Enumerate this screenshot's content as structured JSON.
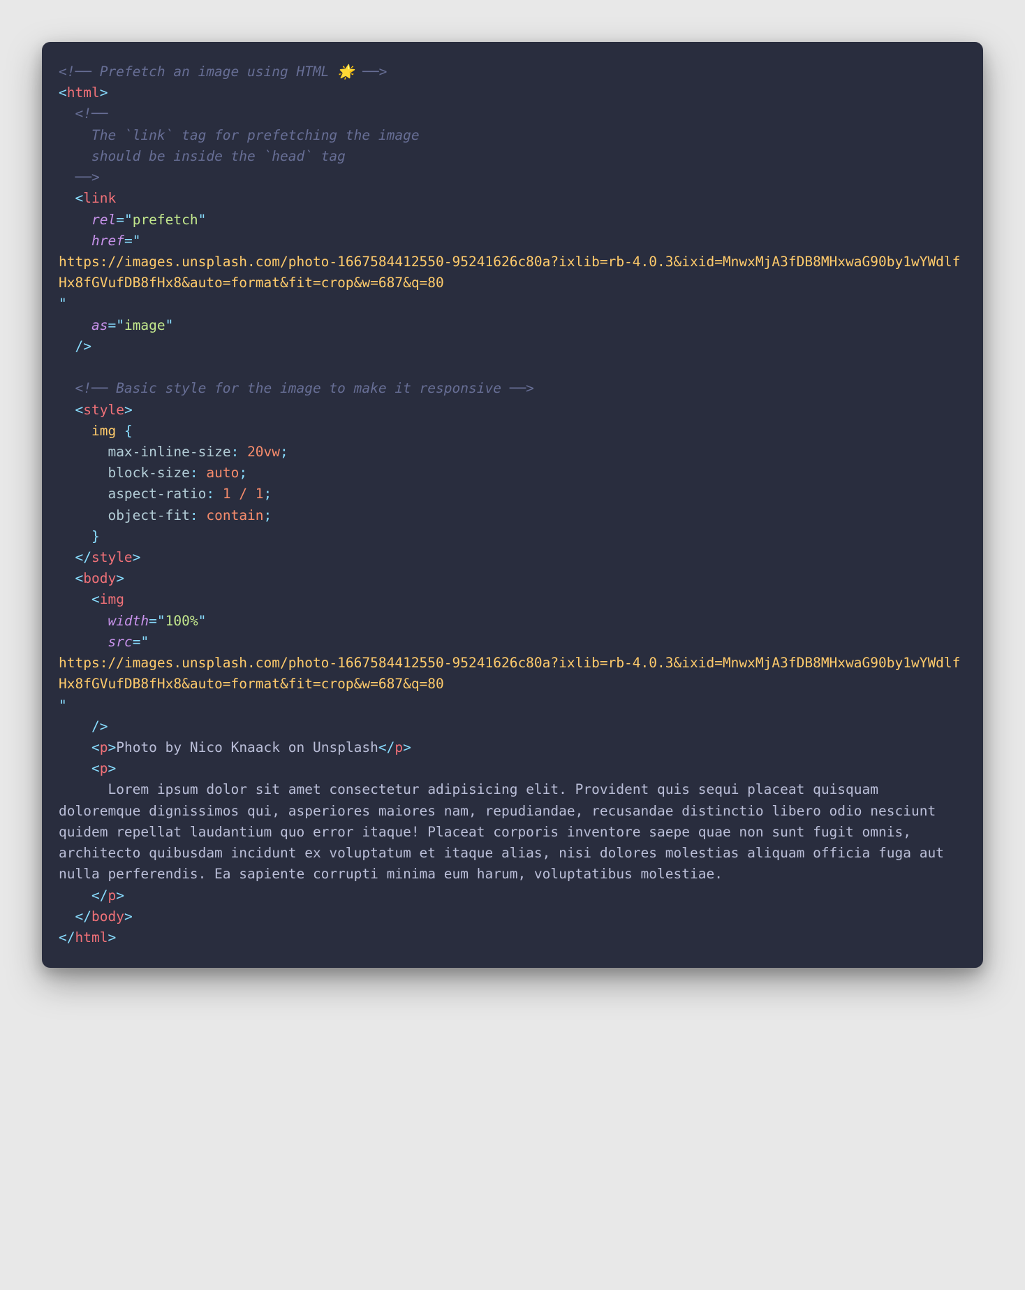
{
  "code": {
    "comment1": "<!── Prefetch an image using HTML 🌟 ──>",
    "htmlOpen": "html",
    "comment2_open": "<!──",
    "comment2_line1": "The `link` tag for prefetching the image",
    "comment2_line2": "should be inside the `head` tag",
    "comment2_close": "──>",
    "linkTag": "link",
    "relAttr": "rel",
    "relVal": "prefetch",
    "hrefAttr": "href",
    "url": "https://images.unsplash.com/photo-1667584412550-95241626c80a?ixlib=rb-4.0.3&ixid=MnwxMjA3fDB8MHxwaG90by1wYWdlfHx8fGVufDB8fHx8&auto=format&fit=crop&w=687&q=80",
    "asAttr": "as",
    "asVal": "image",
    "comment3": "<!── Basic style for the image to make it responsive ──>",
    "styleTag": "style",
    "cssSelector": "img",
    "cssProp1": "max-inline-size",
    "cssVal1": "20vw",
    "cssProp2": "block-size",
    "cssVal2": "auto",
    "cssProp3": "aspect-ratio",
    "cssVal3": "1 / 1",
    "cssProp4": "object-fit",
    "cssVal4": "contain",
    "bodyTag": "body",
    "imgTag": "img",
    "widthAttr": "width",
    "widthVal": "100%",
    "srcAttr": "src",
    "pTag": "p",
    "photoCredit": "Photo by Nico Knaack on Unsplash",
    "lorem": "Lorem ipsum dolor sit amet consectetur adipisicing elit. Provident quis sequi placeat quisquam doloremque dignissimos qui, asperiores maiores nam, repudiandae, recusandae distinctio libero odio nesciunt quidem repellat laudantium quo error itaque! Placeat corporis inventore saepe quae non sunt fugit omnis, architecto quibusdam incidunt ex voluptatum et itaque alias, nisi dolores molestias aliquam officia fuga aut nulla perferendis. Ea sapiente corrupti minima eum harum, voluptatibus molestiae."
  }
}
